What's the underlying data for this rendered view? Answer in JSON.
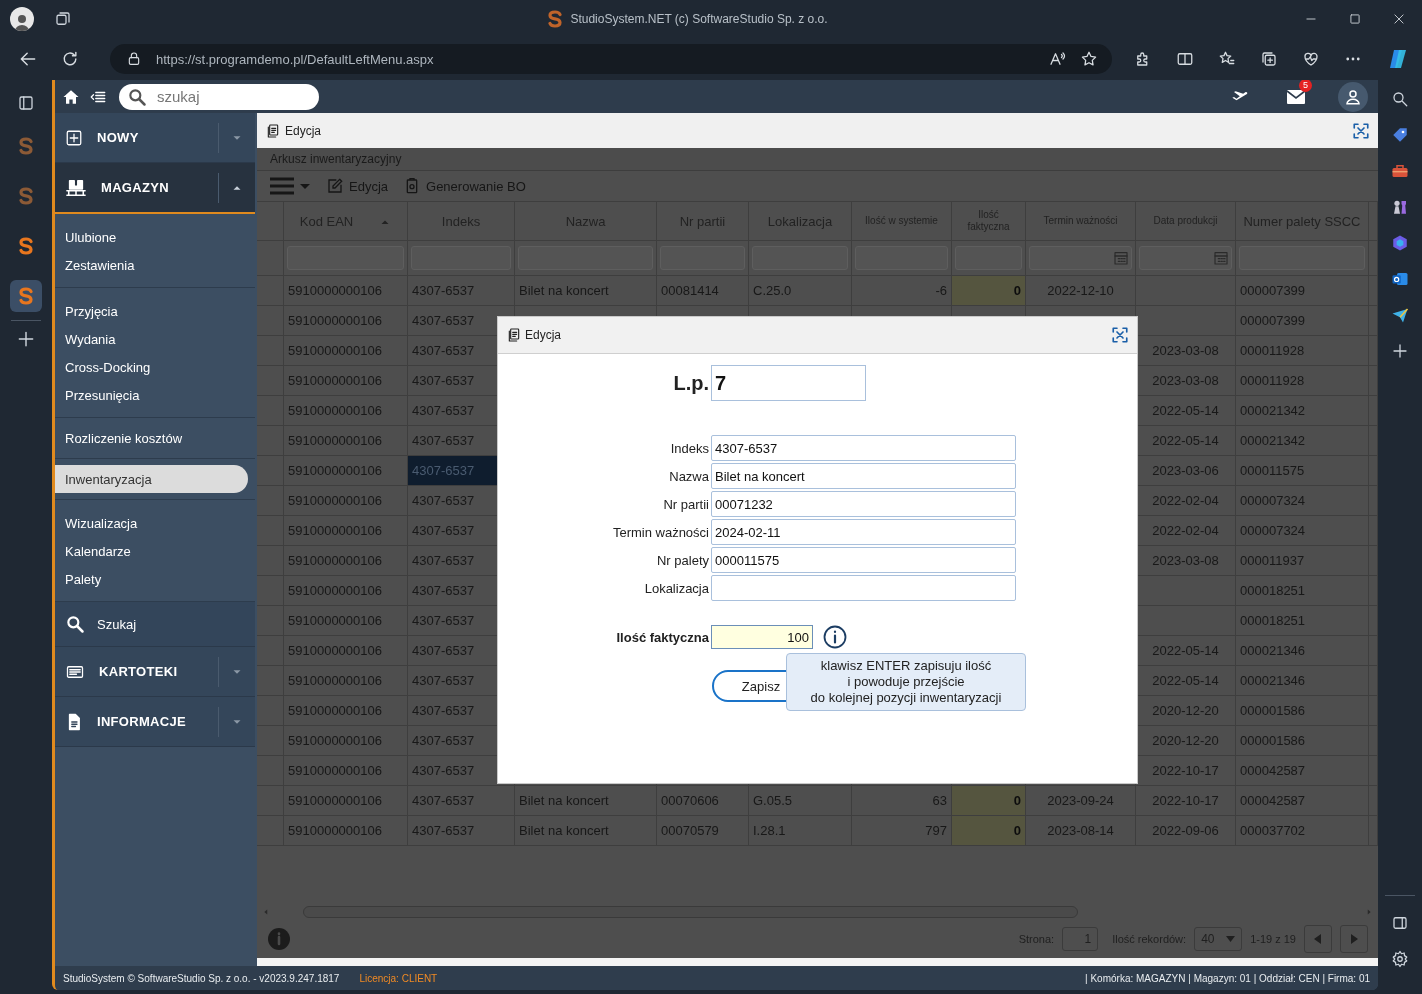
{
  "browser": {
    "title": "StudioSystem.NET (c) SoftwareStudio Sp. z o.o.",
    "url": "https://st.programdemo.pl/DefaultLeftMenu.aspx"
  },
  "pinned_apps": [
    {
      "selected": false
    },
    {
      "selected": false
    },
    {
      "selected": false
    },
    {
      "selected": true
    }
  ],
  "app_bar": {
    "search": {
      "placeholder": "szukaj"
    },
    "mail_badge": "5"
  },
  "sidebar": {
    "sections": [
      {
        "kind": "header",
        "label": "NOWY",
        "expanded": false
      },
      {
        "kind": "header",
        "label": "MAGAZYN",
        "expanded": true
      },
      {
        "kind": "group",
        "items": [
          {
            "label": "Ulubione",
            "selected": false
          },
          {
            "label": "Zestawienia",
            "selected": false
          }
        ]
      },
      {
        "kind": "group",
        "items": [
          {
            "label": "Przyjęcia",
            "selected": false
          },
          {
            "label": "Wydania",
            "selected": false
          },
          {
            "label": "Cross-Docking",
            "selected": false
          },
          {
            "label": "Przesunięcia",
            "selected": false
          }
        ]
      },
      {
        "kind": "group",
        "items": [
          {
            "label": "Rozliczenie kosztów",
            "selected": false
          }
        ]
      },
      {
        "kind": "group",
        "items": [
          {
            "label": "Inwentaryzacja",
            "selected": true
          }
        ]
      },
      {
        "kind": "group",
        "items": [
          {
            "label": "Wizualizacja",
            "selected": false
          },
          {
            "label": "Kalendarze",
            "selected": false
          },
          {
            "label": "Palety",
            "selected": false
          }
        ]
      },
      {
        "kind": "search",
        "label": "Szukaj"
      },
      {
        "kind": "header",
        "label": "KARTOTEKI",
        "expanded": false
      },
      {
        "kind": "header",
        "label": "INFORMACJE",
        "expanded": false
      }
    ]
  },
  "window": {
    "title": "Edycja"
  },
  "sheet": {
    "title": "Arkusz inwentaryzacyjny",
    "toolbar": [
      {
        "label": "Edycja"
      },
      {
        "label": "Generowanie BO"
      }
    ],
    "columns": [
      {
        "label": "Kod EAN",
        "kind": "text",
        "sorted": true
      },
      {
        "label": "Indeks",
        "kind": "text",
        "sorted": false
      },
      {
        "label": "Nazwa",
        "kind": "text",
        "sorted": false
      },
      {
        "label": "Nr partii",
        "kind": "text",
        "sorted": false
      },
      {
        "label": "Lokalizacja",
        "kind": "text",
        "sorted": false
      },
      {
        "label": "Ilość w systemie",
        "kind": "number",
        "sorted": false
      },
      {
        "label": "Ilość faktyczna",
        "kind": "quantity",
        "sorted": false
      },
      {
        "label": "Termin ważności",
        "kind": "date",
        "sorted": false
      },
      {
        "label": "Data produkcji",
        "kind": "date",
        "sorted": false
      },
      {
        "label": "Numer palety SSCC",
        "kind": "text",
        "sorted": false
      }
    ],
    "rows": [
      {
        "selected": false,
        "ean": "5910000000106",
        "index": "4307-6537",
        "name": "Bilet na koncert",
        "batch": "00081414",
        "location": "C.25.0",
        "system_qty": "-6",
        "actual_qty": "0",
        "expiry": "2022-12-10",
        "pallet": "000007399"
      },
      {
        "selected": false,
        "ean": "5910000000106",
        "index": "4307-6537",
        "pallet": "000007399"
      },
      {
        "selected": false,
        "ean": "5910000000106",
        "index": "4307-6537",
        "production": "2023-03-08",
        "pallet": "000011928"
      },
      {
        "selected": false,
        "ean": "5910000000106",
        "index": "4307-6537",
        "production": "2023-03-08",
        "pallet": "000011928"
      },
      {
        "selected": false,
        "ean": "5910000000106",
        "index": "4307-6537",
        "production": "2022-05-14",
        "pallet": "000021342"
      },
      {
        "selected": false,
        "ean": "5910000000106",
        "index": "4307-6537",
        "production": "2022-05-14",
        "pallet": "000021342"
      },
      {
        "selected": true,
        "ean": "5910000000106",
        "index": "4307-6537",
        "production": "2023-03-06",
        "pallet": "000011575"
      },
      {
        "selected": false,
        "ean": "5910000000106",
        "index": "4307-6537",
        "production": "2022-02-04",
        "pallet": "000007324"
      },
      {
        "selected": false,
        "ean": "5910000000106",
        "index": "4307-6537",
        "production": "2022-02-04",
        "pallet": "000007324"
      },
      {
        "selected": false,
        "ean": "5910000000106",
        "index": "4307-6537",
        "production": "2023-03-08",
        "pallet": "000011937"
      },
      {
        "selected": false,
        "ean": "5910000000106",
        "index": "4307-6537",
        "pallet": "000018251"
      },
      {
        "selected": false,
        "ean": "5910000000106",
        "index": "4307-6537",
        "pallet": "000018251"
      },
      {
        "selected": false,
        "ean": "5910000000106",
        "index": "4307-6537",
        "production": "2022-05-14",
        "pallet": "000021346"
      },
      {
        "selected": false,
        "ean": "5910000000106",
        "index": "4307-6537",
        "production": "2022-05-14",
        "pallet": "000021346"
      },
      {
        "selected": false,
        "ean": "5910000000106",
        "index": "4307-6537",
        "production": "2020-12-20",
        "pallet": "000001586"
      },
      {
        "selected": false,
        "ean": "5910000000106",
        "index": "4307-6537",
        "production": "2020-12-20",
        "pallet": "000001586"
      },
      {
        "selected": false,
        "ean": "5910000000106",
        "index": "4307-6537",
        "production": "2022-10-17",
        "pallet": "000042587"
      },
      {
        "selected": false,
        "ean": "5910000000106",
        "index": "4307-6537",
        "name": "Bilet na koncert",
        "batch": "00070606",
        "location": "G.05.5",
        "system_qty": "63",
        "actual_qty": "0",
        "expiry": "2023-09-24",
        "production": "2022-10-17",
        "pallet": "000042587"
      },
      {
        "selected": false,
        "ean": "5910000000106",
        "index": "4307-6537",
        "name": "Bilet na koncert",
        "batch": "00070579",
        "location": "I.28.1",
        "system_qty": "797",
        "actual_qty": "0",
        "expiry": "2023-08-14",
        "production": "2022-09-06",
        "pallet": "000037702"
      }
    ],
    "pager": {
      "page_label": "Strona:",
      "page": "1",
      "size_label": "Ilość rekordów:",
      "size": "40",
      "range": "1-19 z 19"
    }
  },
  "dialog": {
    "title": "Edycja",
    "number_label": "L.p.",
    "number_value": "7",
    "fields": [
      {
        "label": "Indeks",
        "value": "4307-6537"
      },
      {
        "label": "Nazwa",
        "value": "Bilet na koncert"
      },
      {
        "label": "Nr partii",
        "value": "00071232"
      },
      {
        "label": "Termin ważności",
        "value": "2024-02-11"
      },
      {
        "label": "Nr palety",
        "value": "000011575"
      },
      {
        "label": "Lokalizacja"
      }
    ],
    "quantity": {
      "label": "Ilość faktyczna",
      "value": "100"
    },
    "tooltip": "klawisz ENTER zapisuju ilość\ni powoduje przejście\ndo kolejnej pozycji inwentaryzacji",
    "save_button": "Zapisz"
  },
  "status_bar": {
    "left": "StudioSystem © SoftwareStudio Sp. z o.o. - v2023.9.247.1817",
    "license": "Licencja: CLIENT",
    "right": "| Komórka: MAGAZYN | Magazyn: 01 | Oddział: CEN | Firma: 01"
  }
}
